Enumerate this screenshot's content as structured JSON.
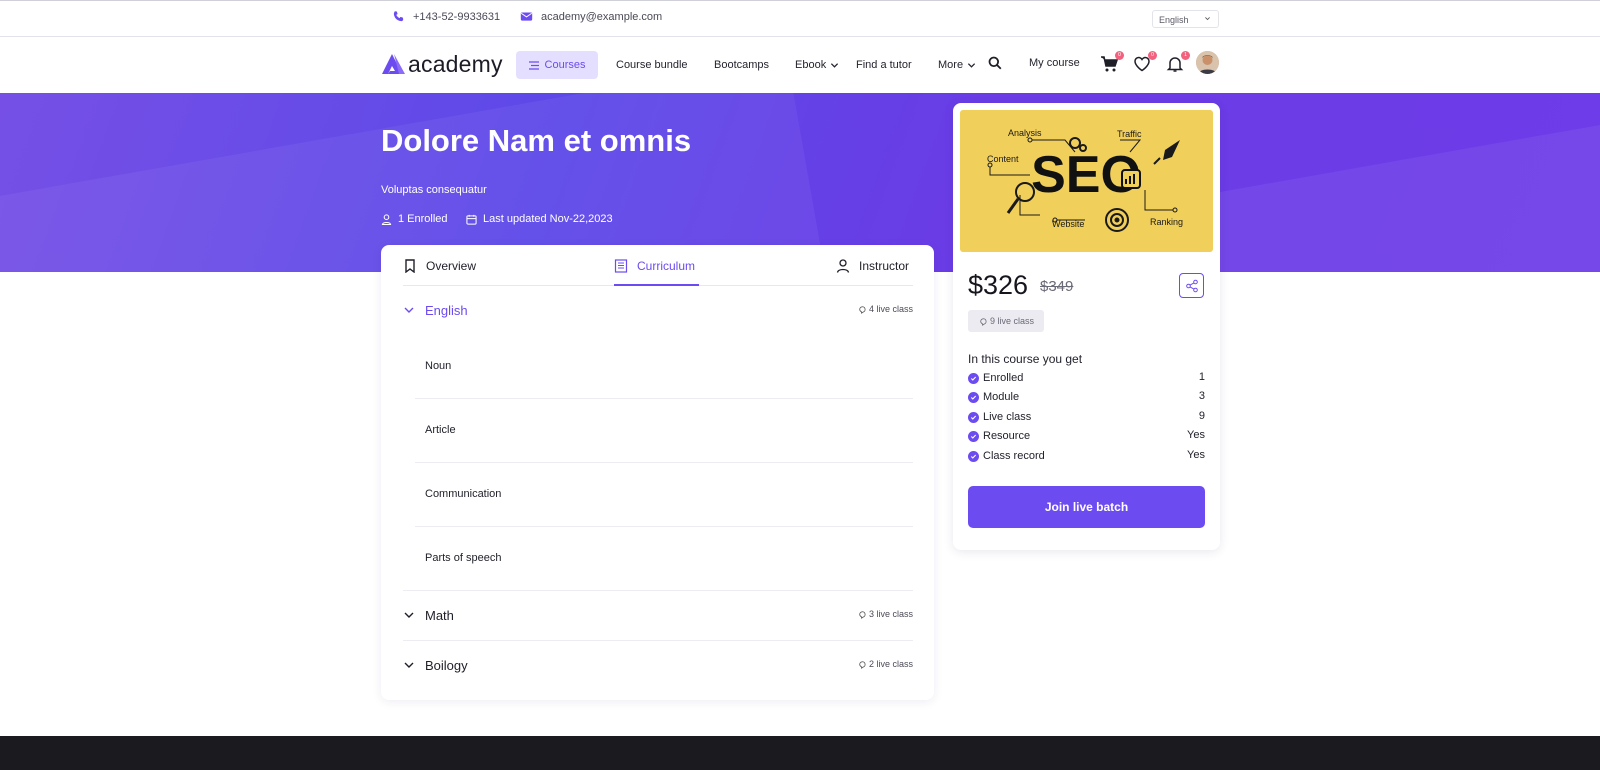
{
  "topbar": {
    "phone": "+143-52-9933631",
    "email": "academy@example.com",
    "language": "English"
  },
  "nav": {
    "logo_text": "academy",
    "courses": "Courses",
    "links": [
      "Course bundle",
      "Bootcamps",
      "Ebook",
      "Find a tutor",
      "More"
    ],
    "my_course": "My course",
    "cart_count": "0",
    "wishlist_count": "0",
    "notification_count": "1"
  },
  "hero": {
    "title": "Dolore Nam et omnis",
    "subtitle": "Voluptas consequatur",
    "enrolled": "1 Enrolled",
    "updated": "Last updated Nov-22,2023"
  },
  "tabs": [
    "Overview",
    "Curriculum",
    "Instructor"
  ],
  "curriculum": {
    "sections": [
      {
        "title": "English",
        "live": "4 live class"
      },
      {
        "title": "Math",
        "live": "3 live class"
      },
      {
        "title": "Boilogy",
        "live": "2 live class"
      }
    ],
    "lessons": [
      "Noun",
      "Article",
      "Communication",
      "Parts of speech"
    ]
  },
  "thumbnail": {
    "main": "SEO",
    "labels": [
      "Analysis",
      "Traffic",
      "Content",
      "Website",
      "Ranking"
    ]
  },
  "sidebar": {
    "price": "$326",
    "old_price": "$349",
    "live_pill": "9 live class",
    "get_title": "In this course you get",
    "features": [
      {
        "label": "Enrolled",
        "value": "1"
      },
      {
        "label": "Module",
        "value": "3"
      },
      {
        "label": "Live class",
        "value": "9"
      },
      {
        "label": "Resource",
        "value": "Yes"
      },
      {
        "label": "Class record",
        "value": "Yes"
      }
    ],
    "join": "Join live batch"
  },
  "colors": {
    "accent": "#6c4bf0",
    "hero_start": "#7650e6",
    "hero_end": "#6e3ce8",
    "thumb_bg": "#f1cf5b",
    "footer": "#1b1b1f"
  }
}
